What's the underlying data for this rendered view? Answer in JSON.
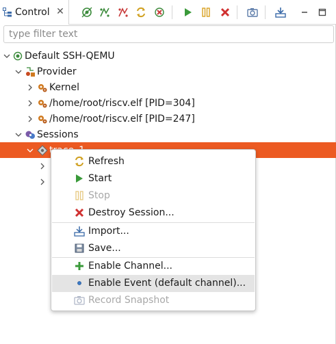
{
  "view": {
    "tab_label": "Control",
    "tab_close": "✕"
  },
  "toolbar": {
    "buttons": [
      {
        "name": "connect-icon",
        "color": "#3a8a3a"
      },
      {
        "name": "enable-icon",
        "color": "#3a8a3a"
      },
      {
        "name": "disable-icon",
        "color": "#c83a3a"
      },
      {
        "name": "refresh-icon",
        "color": "#d0a020"
      },
      {
        "name": "destroy-icon",
        "color": "#c83a3a"
      },
      {
        "name": "start-icon",
        "color": "#3a9a3a"
      },
      {
        "name": "stop-icon",
        "color": "#d8a020"
      },
      {
        "name": "destroy-session-icon",
        "color": "#d03030"
      },
      {
        "name": "snapshot-icon",
        "color": "#5a7aa8"
      },
      {
        "name": "import-icon",
        "color": "#3a6aa8"
      },
      {
        "name": "minimize-icon",
        "color": "#444444"
      },
      {
        "name": "maximize-icon",
        "color": "#444444"
      }
    ]
  },
  "filter": {
    "placeholder": "type filter text"
  },
  "tree": {
    "root": "Default SSH-QEMU",
    "provider": "Provider",
    "provider_items": [
      "Kernel",
      "/home/root/riscv.elf [PID=304]",
      "/home/root/riscv.elf [PID=247]"
    ],
    "sessions": "Sessions",
    "session_selected": "trace_1"
  },
  "context_menu": {
    "items": [
      {
        "label": "Refresh",
        "icon": "refresh-icon",
        "enabled": true
      },
      {
        "label": "Start",
        "icon": "start-icon",
        "enabled": true
      },
      {
        "label": "Stop",
        "icon": "stop-icon",
        "enabled": false
      },
      {
        "label": "Destroy Session...",
        "icon": "destroy-icon",
        "enabled": true
      },
      {
        "label": "Import...",
        "icon": "import-icon",
        "enabled": true
      },
      {
        "label": "Save...",
        "icon": "save-icon",
        "enabled": true
      },
      {
        "label": "Enable Channel...",
        "icon": "add-icon",
        "enabled": true
      },
      {
        "label": "Enable Event (default channel)...",
        "icon": "event-icon",
        "enabled": true
      },
      {
        "label": "Record Snapshot",
        "icon": "snapshot-icon",
        "enabled": false
      }
    ]
  },
  "colors": {
    "selection": "#ec5a22",
    "menu_hover": "#e4e4e4"
  }
}
